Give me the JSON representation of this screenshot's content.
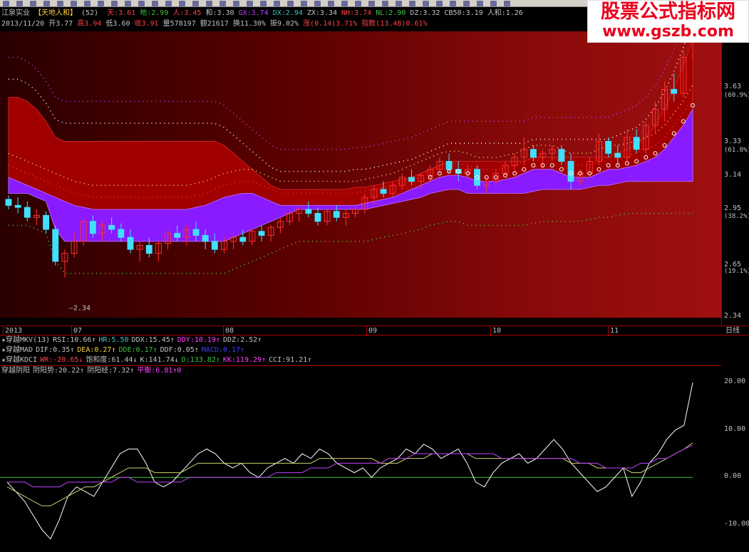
{
  "watermark": {
    "line1": "股票公式指标网",
    "line2": "www.gszb.com"
  },
  "header": {
    "stock": "江泉实业",
    "indicator": "【天地人和】",
    "period": "(52)",
    "items": [
      {
        "label": "天:3.61",
        "color": "#ff4040"
      },
      {
        "label": "地:2.99",
        "color": "#40c040"
      },
      {
        "label": "人:3.45",
        "color": "#ff4040"
      },
      {
        "label": "和:3.30",
        "color": "#c0c0c0"
      },
      {
        "label": "GX:3.74",
        "color": "#c040ff"
      },
      {
        "label": "DX:2.94",
        "color": "#40c0c0"
      },
      {
        "label": "ZX:3.34",
        "color": "#c0c0c0"
      },
      {
        "label": "NH:3.74",
        "color": "#ff4040"
      },
      {
        "label": "NL:2.90",
        "color": "#40c040"
      },
      {
        "label": "DZ:3.32",
        "color": "#c0c0c0"
      },
      {
        "label": "CB50:3.19",
        "color": "#c0c0c0"
      },
      {
        "label": "人和:1.26",
        "color": "#c0c0c0"
      }
    ]
  },
  "quote": {
    "items": [
      {
        "label": "2013/11/20",
        "color": "#c0c0c0"
      },
      {
        "label": "开3.77",
        "color": "#c0c0c0"
      },
      {
        "label": "高3.94",
        "color": "#ff4040"
      },
      {
        "label": "低3.60",
        "color": "#c0c0c0"
      },
      {
        "label": "收3.91",
        "color": "#ff4040"
      },
      {
        "label": "量578197",
        "color": "#c0c0c0"
      },
      {
        "label": "额21617",
        "color": "#c0c0c0"
      },
      {
        "label": "换11.30%",
        "color": "#c0c0c0"
      },
      {
        "label": "振9.02%",
        "color": "#c0c0c0"
      },
      {
        "label": "涨(0.14)3.71%",
        "color": "#ff4040"
      },
      {
        "label": "指数(13.48)0.61%",
        "color": "#ff4040"
      }
    ]
  },
  "axis_labels": [
    {
      "value": "3.63",
      "pct": ""
    },
    {
      "value": "",
      "pct": "(60.9%)"
    },
    {
      "value": "3.33",
      "pct": ""
    },
    {
      "value": "",
      "pct": "(61.8%)"
    },
    {
      "value": "3.14",
      "pct": ""
    },
    {
      "value": "2.95",
      "pct": ""
    },
    {
      "value": "",
      "pct": "(38.2%)"
    },
    {
      "value": "2.65",
      "pct": ""
    },
    {
      "value": "",
      "pct": "(19.1%)"
    },
    {
      "value": "2.34",
      "pct": ""
    }
  ],
  "low_marker": "2.34",
  "dates": [
    "2013",
    "07",
    "08",
    "09",
    "10",
    "11"
  ],
  "date_right_label": "日线",
  "indicators": {
    "mkv": [
      {
        "label": "★穿越MKV(13)",
        "color": "#c0c0c0"
      },
      {
        "label": "RSI:10.66↑",
        "color": "#c0c0c0"
      },
      {
        "label": "HR:5.50",
        "color": "#40c0c0"
      },
      {
        "label": "DDX:15.45↑",
        "color": "#c0c0c0"
      },
      {
        "label": "DDY:10.19↑",
        "color": "#ff40ff"
      },
      {
        "label": "DDZ:2.52↑",
        "color": "#c0c0c0"
      }
    ],
    "mad": [
      {
        "label": "★穿越MAD",
        "color": "#c0c0c0"
      },
      {
        "label": "DIF:0.35↑",
        "color": "#c0c0c0"
      },
      {
        "label": "DEA:0.27↑",
        "color": "#ffd040"
      },
      {
        "label": "DDE:0.17↑",
        "color": "#40c040"
      },
      {
        "label": "DDF:0.05↑",
        "color": "#c0c0c0"
      },
      {
        "label": "MACD:0.17↑",
        "color": "#4040ff"
      }
    ],
    "kdci": [
      {
        "label": "★穿越KDCI",
        "color": "#c0c0c0"
      },
      {
        "label": "WR:-20.65↓",
        "color": "#ff4040"
      },
      {
        "label": "饱和度:61.44↓",
        "color": "#c0c0c0"
      },
      {
        "label": "K:141.74↓",
        "color": "#c0c0c0"
      },
      {
        "label": "D:133.82↑",
        "color": "#40c040"
      },
      {
        "label": "KK:119.29↑",
        "color": "#ff40ff"
      },
      {
        "label": "CCI:91.21↑",
        "color": "#c0c0c0"
      }
    ],
    "yinyang": [
      {
        "label": "穿越阴阳",
        "color": "#c0c0c0"
      },
      {
        "label": "阴阳势:20.22↑",
        "color": "#c0c0c0"
      },
      {
        "label": "阴阳经:7.32↑",
        "color": "#c0c0c0"
      },
      {
        "label": "平衡:6.81↑0",
        "color": "#ff40ff"
      }
    ]
  },
  "osc_axis": [
    "20.00",
    "10.00",
    "0.00",
    "-10.00"
  ],
  "chart_data": [
    {
      "type": "line",
      "title": "天地人和",
      "ylim": [
        2.34,
        3.7
      ],
      "candles": [
        [
          2.91,
          2.93,
          2.86,
          2.88
        ],
        [
          2.88,
          2.92,
          2.84,
          2.87
        ],
        [
          2.87,
          2.9,
          2.8,
          2.82
        ],
        [
          2.82,
          2.86,
          2.78,
          2.83
        ],
        [
          2.83,
          2.85,
          2.74,
          2.76
        ],
        [
          2.76,
          2.78,
          2.58,
          2.6
        ],
        [
          2.6,
          2.66,
          2.52,
          2.64
        ],
        [
          2.64,
          2.74,
          2.62,
          2.7
        ],
        [
          2.7,
          2.82,
          2.68,
          2.8
        ],
        [
          2.8,
          2.83,
          2.72,
          2.74
        ],
        [
          2.74,
          2.8,
          2.7,
          2.78
        ],
        [
          2.78,
          2.82,
          2.74,
          2.76
        ],
        [
          2.76,
          2.79,
          2.7,
          2.72
        ],
        [
          2.72,
          2.76,
          2.64,
          2.66
        ],
        [
          2.66,
          2.7,
          2.6,
          2.68
        ],
        [
          2.68,
          2.72,
          2.62,
          2.64
        ],
        [
          2.64,
          2.7,
          2.6,
          2.69
        ],
        [
          2.69,
          2.76,
          2.66,
          2.74
        ],
        [
          2.74,
          2.78,
          2.7,
          2.72
        ],
        [
          2.72,
          2.78,
          2.68,
          2.76
        ],
        [
          2.76,
          2.8,
          2.7,
          2.73
        ],
        [
          2.73,
          2.76,
          2.66,
          2.7
        ],
        [
          2.7,
          2.74,
          2.64,
          2.66
        ],
        [
          2.66,
          2.72,
          2.64,
          2.7
        ],
        [
          2.7,
          2.74,
          2.66,
          2.72
        ],
        [
          2.72,
          2.76,
          2.68,
          2.7
        ],
        [
          2.7,
          2.76,
          2.68,
          2.75
        ],
        [
          2.75,
          2.78,
          2.7,
          2.73
        ],
        [
          2.73,
          2.78,
          2.7,
          2.77
        ],
        [
          2.77,
          2.82,
          2.74,
          2.8
        ],
        [
          2.8,
          2.86,
          2.78,
          2.84
        ],
        [
          2.84,
          2.88,
          2.8,
          2.86
        ],
        [
          2.86,
          2.9,
          2.82,
          2.84
        ],
        [
          2.84,
          2.87,
          2.78,
          2.8
        ],
        [
          2.8,
          2.86,
          2.78,
          2.85
        ],
        [
          2.85,
          2.88,
          2.8,
          2.82
        ],
        [
          2.82,
          2.86,
          2.78,
          2.84
        ],
        [
          2.84,
          2.88,
          2.82,
          2.86
        ],
        [
          2.86,
          2.94,
          2.84,
          2.92
        ],
        [
          2.92,
          2.98,
          2.88,
          2.96
        ],
        [
          2.96,
          3.0,
          2.92,
          2.94
        ],
        [
          2.94,
          3.0,
          2.92,
          2.98
        ],
        [
          2.98,
          3.04,
          2.96,
          3.02
        ],
        [
          3.02,
          3.06,
          2.98,
          3.0
        ],
        [
          3.0,
          3.04,
          2.96,
          3.03
        ],
        [
          3.03,
          3.08,
          3.0,
          3.06
        ],
        [
          3.06,
          3.12,
          3.04,
          3.1
        ],
        [
          3.1,
          3.14,
          3.04,
          3.06
        ],
        [
          3.06,
          3.1,
          3.0,
          3.04
        ],
        [
          3.04,
          3.08,
          3.02,
          3.06
        ],
        [
          3.06,
          3.08,
          2.96,
          2.98
        ],
        [
          2.98,
          3.02,
          2.94,
          3.0
        ],
        [
          3.0,
          3.06,
          2.98,
          3.04
        ],
        [
          3.04,
          3.1,
          3.02,
          3.08
        ],
        [
          3.08,
          3.14,
          3.04,
          3.12
        ],
        [
          3.12,
          3.22,
          3.08,
          3.16
        ],
        [
          3.16,
          3.18,
          3.1,
          3.12
        ],
        [
          3.12,
          3.16,
          3.06,
          3.14
        ],
        [
          3.14,
          3.18,
          3.1,
          3.16
        ],
        [
          3.16,
          3.18,
          3.08,
          3.1
        ],
        [
          3.1,
          3.14,
          2.96,
          3.0
        ],
        [
          3.0,
          3.06,
          2.98,
          3.04
        ],
        [
          3.04,
          3.12,
          3.02,
          3.1
        ],
        [
          3.1,
          3.24,
          3.08,
          3.2
        ],
        [
          3.2,
          3.22,
          3.12,
          3.14
        ],
        [
          3.14,
          3.18,
          3.08,
          3.12
        ],
        [
          3.12,
          3.26,
          3.1,
          3.22
        ],
        [
          3.22,
          3.26,
          3.14,
          3.16
        ],
        [
          3.16,
          3.3,
          3.14,
          3.28
        ],
        [
          3.28,
          3.4,
          3.24,
          3.36
        ],
        [
          3.36,
          3.5,
          3.3,
          3.46
        ],
        [
          3.46,
          3.54,
          3.4,
          3.44
        ],
        [
          3.44,
          3.66,
          3.42,
          3.62
        ],
        [
          3.77,
          3.94,
          3.6,
          3.91
        ]
      ],
      "sky_band": [
        3.42,
        3.42,
        3.4,
        3.36,
        3.3,
        3.22,
        3.2,
        3.2,
        3.2,
        3.2,
        3.2,
        3.2,
        3.2,
        3.2,
        3.2,
        3.2,
        3.2,
        3.2,
        3.2,
        3.2,
        3.2,
        3.2,
        3.2,
        3.18,
        3.14,
        3.1,
        3.06,
        3.02,
        2.98,
        2.96,
        2.96,
        2.96,
        2.96,
        2.96,
        2.96,
        2.96,
        2.96,
        2.97,
        2.97,
        2.98,
        2.99,
        3.0,
        3.01,
        3.02,
        3.04,
        3.06,
        3.08,
        3.1,
        3.1,
        3.1,
        3.1,
        3.1,
        3.1,
        3.1,
        3.1,
        3.1,
        3.12,
        3.12,
        3.12,
        3.12,
        3.12,
        3.12,
        3.12,
        3.12,
        3.12,
        3.14,
        3.16,
        3.18,
        3.22,
        3.28,
        3.36,
        3.46,
        3.58,
        3.7
      ],
      "earth_band": [
        2.94,
        2.94,
        2.94,
        2.92,
        2.9,
        2.76,
        2.7,
        2.7,
        2.7,
        2.7,
        2.7,
        2.7,
        2.7,
        2.7,
        2.7,
        2.7,
        2.7,
        2.7,
        2.7,
        2.7,
        2.7,
        2.7,
        2.7,
        2.7,
        2.72,
        2.74,
        2.76,
        2.78,
        2.8,
        2.82,
        2.84,
        2.86,
        2.86,
        2.86,
        2.86,
        2.86,
        2.86,
        2.86,
        2.86,
        2.87,
        2.88,
        2.89,
        2.9,
        2.91,
        2.92,
        2.94,
        2.95,
        2.96,
        2.96,
        2.94,
        2.94,
        2.94,
        2.94,
        2.94,
        2.94,
        2.94,
        2.95,
        2.96,
        2.96,
        2.96,
        2.96,
        2.96,
        2.97,
        2.98,
        2.98,
        2.99,
        3.0,
        3.0,
        3.0,
        3.0,
        3.0,
        3.0,
        3.0,
        3.0
      ],
      "person_band": [
        3.02,
        3.0,
        2.98,
        2.96,
        2.94,
        2.92,
        2.9,
        2.88,
        2.87,
        2.86,
        2.86,
        2.86,
        2.86,
        2.86,
        2.86,
        2.86,
        2.86,
        2.86,
        2.86,
        2.86,
        2.87,
        2.88,
        2.9,
        2.92,
        2.93,
        2.94,
        2.94,
        2.92,
        2.9,
        2.88,
        2.88,
        2.88,
        2.88,
        2.88,
        2.88,
        2.88,
        2.88,
        2.88,
        2.89,
        2.9,
        2.91,
        2.92,
        2.94,
        2.96,
        2.98,
        3.0,
        3.02,
        3.03,
        3.03,
        3.02,
        3.0,
        3.0,
        3.0,
        3.01,
        3.02,
        3.04,
        3.06,
        3.06,
        3.06,
        3.04,
        3.02,
        3.02,
        3.02,
        3.04,
        3.06,
        3.06,
        3.07,
        3.08,
        3.1,
        3.12,
        3.16,
        3.22,
        3.28,
        3.36
      ]
    },
    {
      "type": "line",
      "title": "穿越阴阳",
      "ylim": [
        -15,
        22
      ],
      "series": [
        {
          "name": "阴阳势",
          "values": [
            -1,
            -3,
            -5,
            -8,
            -11,
            -13,
            -9,
            -4,
            -2,
            -3,
            -4,
            -1,
            2,
            5,
            6,
            6,
            3,
            -1,
            -2,
            -1,
            1,
            3,
            5,
            6,
            5,
            3,
            2,
            3,
            1,
            0,
            2,
            3,
            4,
            3,
            5,
            4,
            6,
            5,
            3,
            2,
            1,
            2,
            0,
            2,
            3,
            4,
            6,
            5,
            7,
            6,
            4,
            5,
            6,
            3,
            -1,
            -2,
            1,
            3,
            4,
            5,
            3,
            4,
            6,
            8,
            6,
            3,
            1,
            -1,
            -3,
            -2,
            0,
            2,
            -4,
            -1,
            3,
            5,
            8,
            10,
            11,
            20
          ]
        },
        {
          "name": "阴阳经",
          "values": [
            -2,
            -3,
            -4,
            -5,
            -6,
            -6,
            -5,
            -4,
            -3,
            -2,
            -2,
            -1,
            0,
            1,
            2,
            2,
            2,
            1,
            1,
            1,
            1,
            2,
            3,
            3,
            3,
            3,
            3,
            3,
            3,
            3,
            3,
            3,
            3,
            3,
            3,
            3,
            4,
            4,
            4,
            4,
            4,
            4,
            4,
            3,
            3,
            3,
            4,
            4,
            4,
            5,
            5,
            5,
            5,
            5,
            4,
            4,
            4,
            4,
            4,
            4,
            4,
            4,
            4,
            4,
            4,
            3,
            3,
            3,
            2,
            2,
            2,
            2,
            1,
            1,
            2,
            3,
            4,
            5,
            6,
            7.3
          ]
        },
        {
          "name": "平衡",
          "values": [
            -1,
            -1,
            -1,
            -2,
            -2,
            -2,
            -2,
            -1,
            -1,
            -1,
            -1,
            -1,
            -1,
            0,
            0,
            -1,
            -1,
            -1,
            -1,
            -1,
            -1,
            0,
            0,
            0,
            0,
            0,
            0,
            0,
            0,
            0,
            0,
            1,
            1,
            1,
            1,
            2,
            2,
            2,
            3,
            3,
            3,
            3,
            3,
            3,
            4,
            4,
            4,
            5,
            5,
            5,
            5,
            5,
            5,
            5,
            5,
            5,
            5,
            4,
            4,
            4,
            4,
            4,
            4,
            4,
            4,
            4,
            3,
            3,
            3,
            2,
            2,
            2,
            2,
            3,
            3,
            4,
            4,
            5,
            6,
            6.8
          ]
        }
      ]
    }
  ]
}
